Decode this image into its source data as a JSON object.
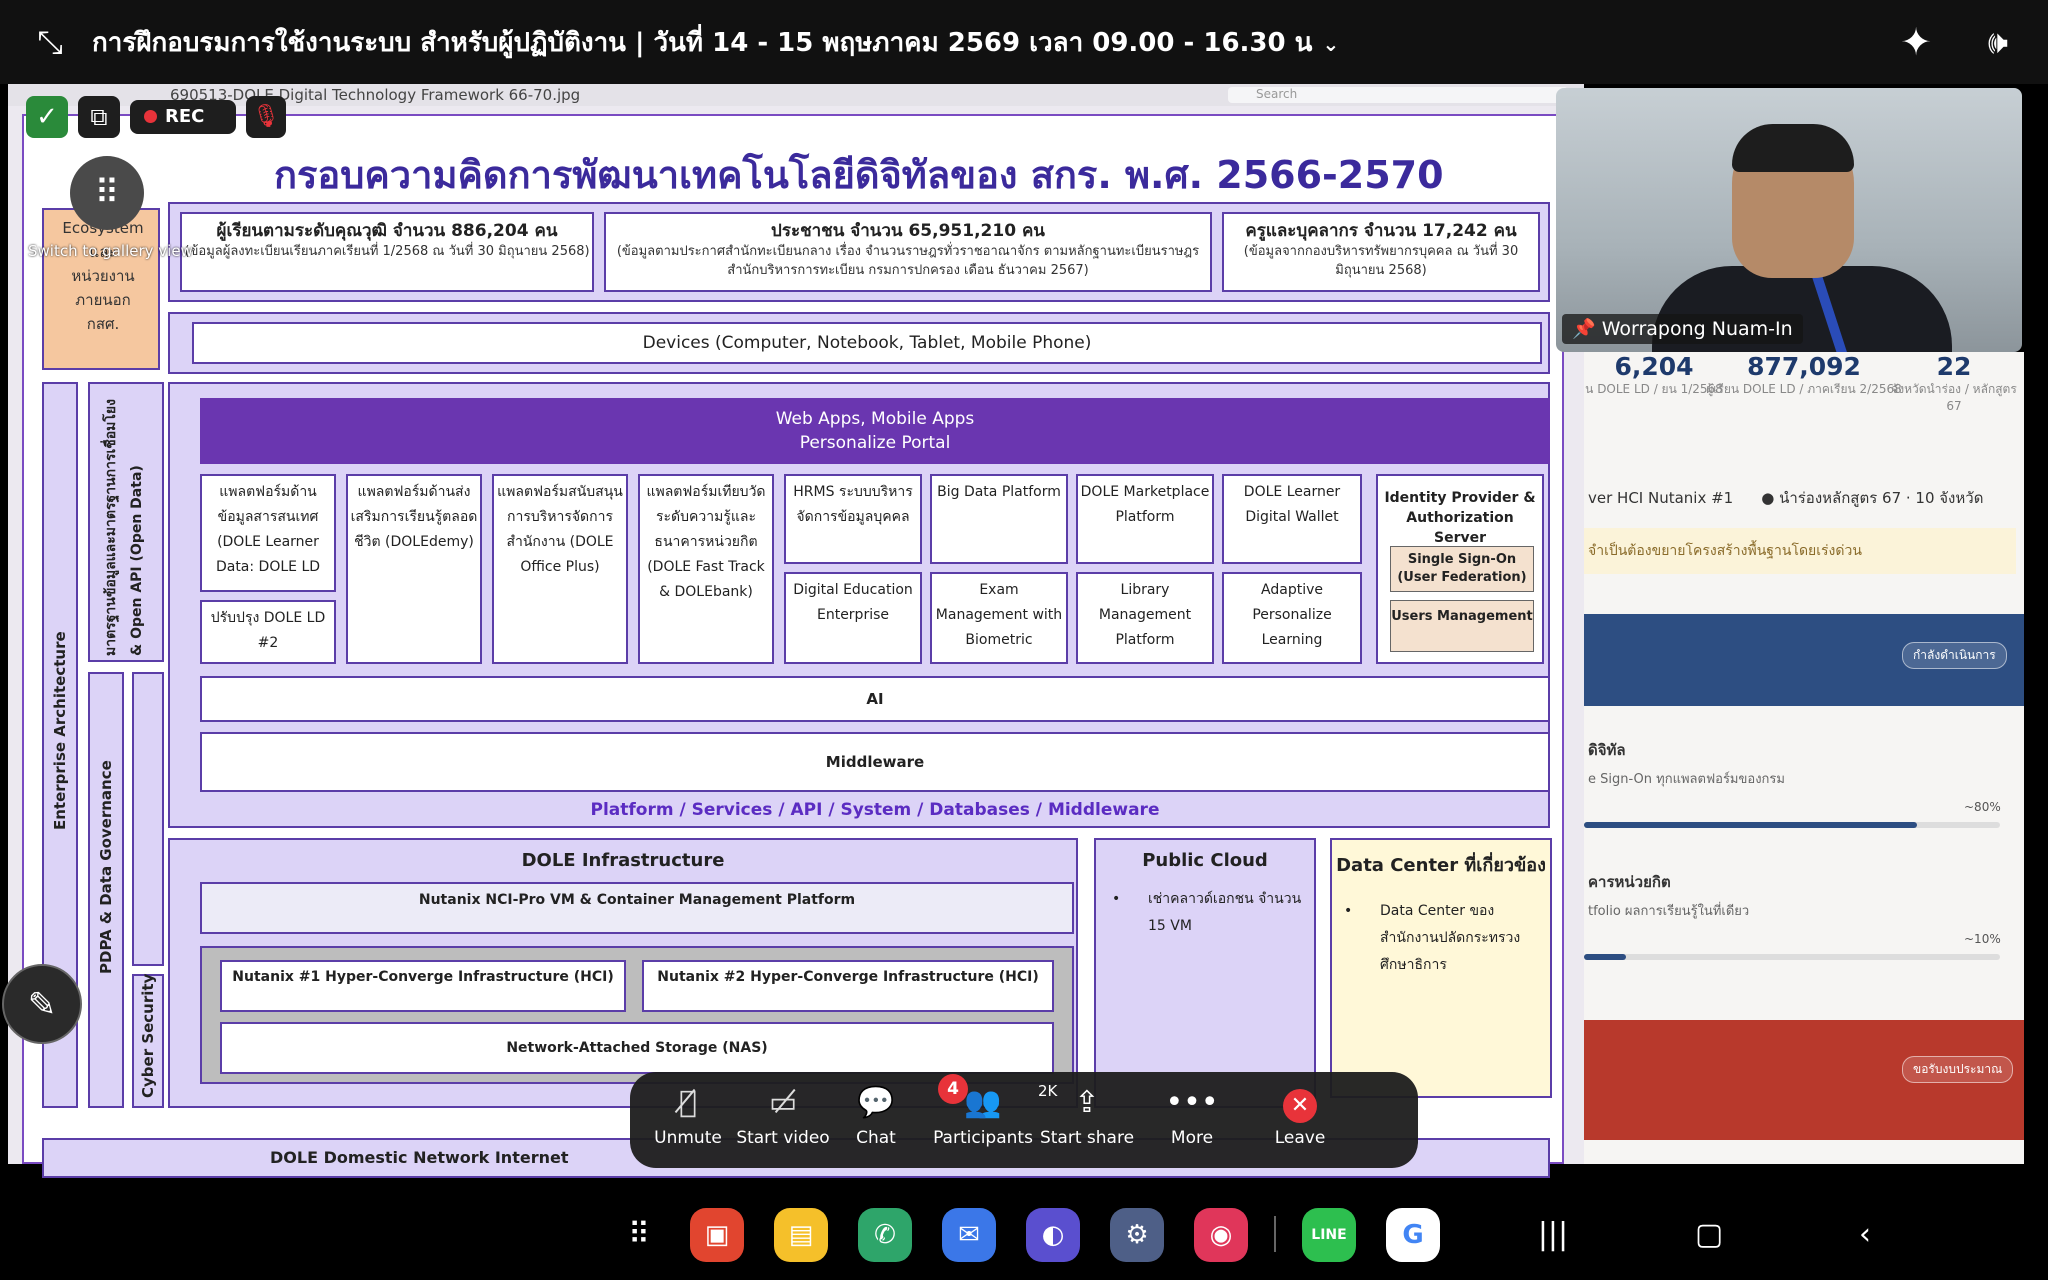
{
  "meeting": {
    "title": "การฝึกอบรมการใช้งานระบบ สำหรับผู้ปฏิบัติงาน | วันที่ 14 - 15 พฤษภาคม 2569  เวลา 09.00 - 16.30 น"
  },
  "viewer": {
    "filename": "690513-DOLE Digital Technology Framework 66-70.jpg",
    "search_placeholder": "Search"
  },
  "slide": {
    "title": "กรอบความคิดการพัฒนาเทคโนโลยีดิจิทัลของ สกร. พ.ศ. 2566-2570",
    "ecosystem": [
      "Ecosystem",
      "และ",
      "หน่วยงาน",
      "ภายนอก",
      "กสศ."
    ],
    "stats": [
      {
        "main": "ผู้เรียนตามระดับคุณวุฒิ จำนวน 886,204 คน",
        "sub": "(ข้อมูลผู้ลงทะเบียนเรียนภาคเรียนที่ 1/2568 ณ วันที่ 30 มิถุนายน 2568)"
      },
      {
        "main": "ประชาชน จำนวน 65,951,210 คน",
        "sub": "(ข้อมูลตามประกาศสำนักทะเบียนกลาง เรื่อง จำนวนราษฎรทั่วราชอาณาจักร ตามหลักฐานทะเบียนราษฎร สำนักบริหารการทะเบียน กรมการปกครอง เดือน ธันวาคม 2567)"
      },
      {
        "main": "ครูและบุคลากร จำนวน 17,242 คน",
        "sub": "(ข้อมูลจากกองบริหารทรัพยากรบุคคล ณ วันที่ 30 มิถุนายน 2568)"
      }
    ],
    "devices": "Devices (Computer, Notebook, Tablet, Mobile Phone)",
    "enterprise_architecture": "Enterprise Architecture",
    "open_api": "มาตรฐานข้อมูลและมาตรฐานการเชื่อมโยง & Open API (Open Data)",
    "pdpa": "PDPA & Data Governance",
    "cyber": "Cyber Security",
    "banner_line1": "Web Apps, Mobile Apps",
    "banner_line2": "Personalize Portal",
    "platforms": {
      "p1": "แพลตฟอร์มด้านข้อมูลสารสนเทศ (DOLE Learner Data: DOLE LD",
      "p1b": "ปรับปรุง DOLE LD #2",
      "p2": "แพลตฟอร์มด้านส่งเสริมการเรียนรู้ตลอดชีวิต (DOLEdemy)",
      "p3": "แพลตฟอร์มสนับสนุนการบริหารจัดการสำนักงาน (DOLE Office Plus)",
      "p4": "แพลตฟอร์มเทียบวัดระดับความรู้และธนาคารหน่วยกิต (DOLE Fast Track & DOLEbank)",
      "p5a": "HRMS ระบบบริหารจัดการข้อมูลบุคคล",
      "p5b": "Digital Education Enterprise",
      "p6a": "Big Data Platform",
      "p6b": "Exam Management with Biometric",
      "p7a": "DOLE Marketplace Platform",
      "p7b": "Library Management Platform",
      "p8a": "DOLE Learner Digital Wallet",
      "p8b": "Adaptive Personalize Learning"
    },
    "idp": {
      "title": "Identity Provider & Authorization Server",
      "sso": "Single Sign-On (User Federation)",
      "users": "Users Management"
    },
    "ai": "AI",
    "middleware": "Middleware",
    "platform_caption": "Platform / Services / API / System / Databases / Middleware",
    "infra_title": "DOLE Infrastructure",
    "nci": "Nutanix NCI-Pro VM & Container Management Platform",
    "n1": "Nutanix #1 Hyper-Converge Infrastructure (HCI)",
    "n2": "Nutanix #2 Hyper-Converge Infrastructure (HCI)",
    "nas": "Network-Attached Storage (NAS)",
    "public_cloud_title": "Public Cloud",
    "public_cloud_text": "เช่าคลาวด์เอกชน จำนวน 15 VM",
    "dc_title": "Data Center ที่เกี่ยวข้อง",
    "dc_text": "Data Center ของสำนักงานปลัดกระทรวงศึกษาธิการ",
    "network": "DOLE Domestic Network Internet"
  },
  "overlays": {
    "rec": "REC",
    "gallery_hint": "Switch to gallery view"
  },
  "video": {
    "name": "Worrapong Nuam-In"
  },
  "dashboard": {
    "stats": [
      {
        "num": "6,204",
        "lbl": "น DOLE LD / ยน 1/2568"
      },
      {
        "num": "877,092",
        "lbl": "ผู้เรียน DOLE LD / ภาคเรียน 2/2568"
      },
      {
        "num": "22",
        "lbl": "จังหวัดนำร่อง / หลักสูตร 67"
      }
    ],
    "line1a": "ver HCI Nutanix #1",
    "line1b": "● นำร่องหลักสูตร 67 · 10 จังหวัด",
    "note": "จำเป็นต้องขยายโครงสร้างพื้นฐานโดยเร่งด่วน",
    "pill1": "กำลังดำเนินการ",
    "sec1": "ดิจิทัล",
    "sub1": "e Sign-On ทุกแพลตฟอร์มของกรม",
    "pct1": "~80%",
    "prog1": 0.8,
    "sec2": "คารหน่วยกิต",
    "sub2": "tfolio ผลการเรียนรู้ในที่เดียว",
    "pct2": "~10%",
    "prog2": 0.1,
    "pill2": "ขอรับงบประมาณ"
  },
  "controls": {
    "unmute": "Unmute",
    "start_video": "Start video",
    "chat": "Chat",
    "chat_badge": "4",
    "participants": "Participants",
    "participants_count": "2K",
    "start_share": "Start share",
    "more": "More",
    "leave": "Leave"
  },
  "colors": {
    "panel_purple": "#dcd3f7",
    "banner_purple": "#6a36b0",
    "border_purple": "#5b3da8",
    "title_blue": "#3b2a9c",
    "ecosystem_peach": "#f5c79f",
    "rec_red": "#e8333a"
  }
}
